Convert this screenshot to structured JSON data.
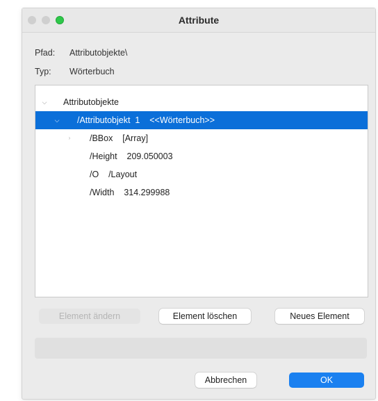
{
  "window": {
    "title": "Attribute"
  },
  "fields": {
    "path": {
      "label": "Pfad:",
      "value": "Attributobjekte\\"
    },
    "type": {
      "label": "Typ:",
      "value": "Wörterbuch"
    }
  },
  "tree": {
    "root": {
      "label": "Attributobjekte"
    },
    "object": {
      "label": "/Attributobjekt  1    <<Wörterbuch>>"
    },
    "children": [
      {
        "label": "/BBox    [Array]"
      },
      {
        "label": "/Height    209.050003"
      },
      {
        "label": "/O    /Layout"
      },
      {
        "label": "/Width    314.299988"
      }
    ]
  },
  "buttons": {
    "edit": "Element ändern",
    "delete": "Element löschen",
    "new": "Neues Element",
    "cancel": "Abbrechen",
    "ok": "OK"
  },
  "colors": {
    "selection": "#0b6fd9",
    "primary_button": "#1a80f0",
    "zoom_light": "#2ec84a"
  }
}
